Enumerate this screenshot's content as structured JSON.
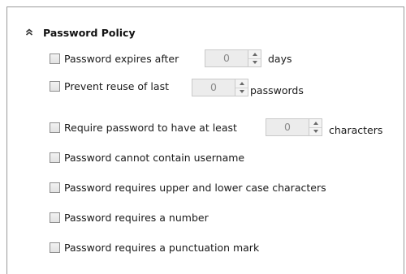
{
  "section": {
    "title": "Password Policy",
    "icon": "chevron-double-up-icon"
  },
  "expires": {
    "label": "Password expires after",
    "value": "0",
    "unit": "days",
    "checked": false
  },
  "reuse": {
    "label": "Prevent reuse of last",
    "value": "0",
    "unit": "passwords",
    "checked": false
  },
  "min_length": {
    "label": "Require password to have at least",
    "value": "0",
    "unit": "characters",
    "checked": false
  },
  "options": [
    {
      "label": "Password cannot contain username",
      "checked": false
    },
    {
      "label": "Password requires upper and lower case characters",
      "checked": false
    },
    {
      "label": "Password requires a number",
      "checked": false
    },
    {
      "label": "Password requires a punctuation mark",
      "checked": false
    }
  ]
}
